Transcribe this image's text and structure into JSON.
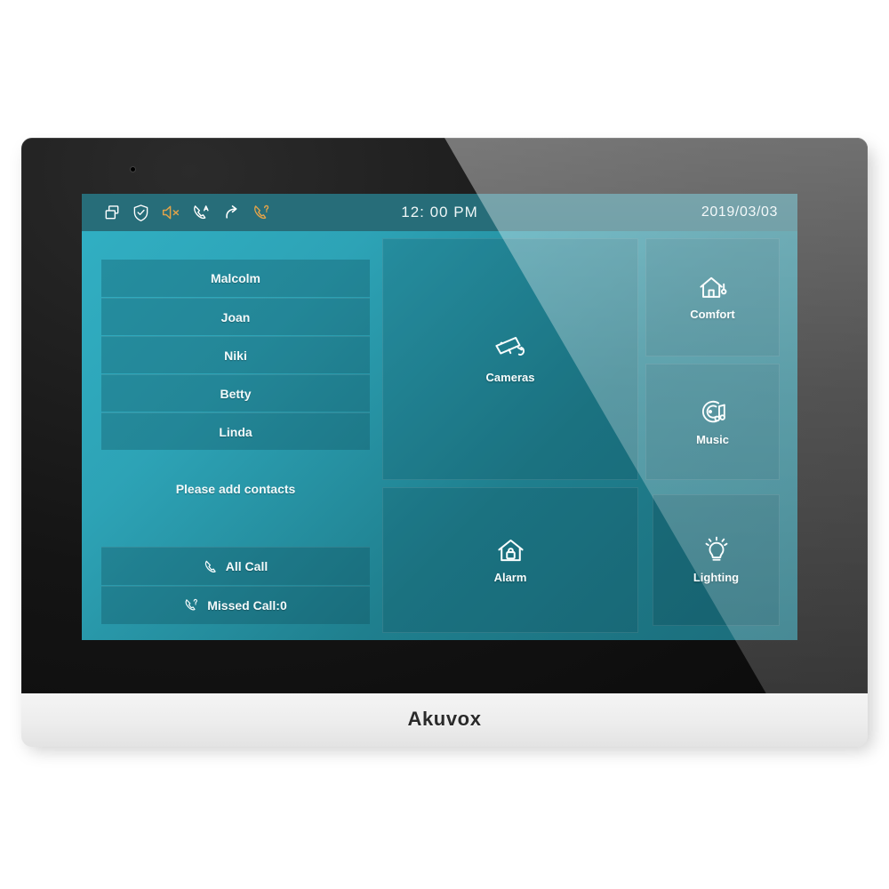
{
  "device": {
    "brand": "Akuvox",
    "camera_dot": "front-camera"
  },
  "statusbar": {
    "time": "12: 00 PM",
    "date": "2019/03/03",
    "icons": [
      {
        "name": "multi-window-icon",
        "label": "Multi Window",
        "color": "#ffffff"
      },
      {
        "name": "shield-check-icon",
        "label": "Security Shield",
        "color": "#ffffff"
      },
      {
        "name": "speaker-mute-icon",
        "label": "Sound Muted",
        "color": "#e0a34a"
      },
      {
        "name": "call-auto-answer-icon",
        "label": "Auto Answer",
        "color": "#ffffff"
      },
      {
        "name": "call-forward-icon",
        "label": "Call Forward",
        "color": "#ffffff"
      },
      {
        "name": "call-dnd-icon",
        "label": "Do Not Disturb",
        "color": "#e0a34a"
      }
    ]
  },
  "contacts": {
    "items": [
      {
        "name": "Malcolm"
      },
      {
        "name": "Joan"
      },
      {
        "name": "Niki"
      },
      {
        "name": "Betty"
      },
      {
        "name": "Linda"
      }
    ],
    "hint": "Please add contacts",
    "all_call": "All Call",
    "missed_call": "Missed Call:0"
  },
  "tiles": [
    {
      "id": "cameras",
      "label": "Cameras",
      "icon": "cctv-camera-icon"
    },
    {
      "id": "comfort",
      "label": "Comfort",
      "icon": "house-thermostat-icon"
    },
    {
      "id": "music",
      "label": "Music",
      "icon": "vinyl-record-music-icon"
    },
    {
      "id": "alarm",
      "label": "Alarm",
      "icon": "house-lock-icon"
    },
    {
      "id": "lighting",
      "label": "Lighting",
      "icon": "light-bulb-icon"
    }
  ],
  "colors": {
    "screen_teal_light": "#31b0c4",
    "screen_teal_dark": "#1b6d7b",
    "statusbar": "#276d79",
    "accent_amber": "#e0a34a",
    "bezel_black": "#141414",
    "base_white": "#ededed"
  }
}
